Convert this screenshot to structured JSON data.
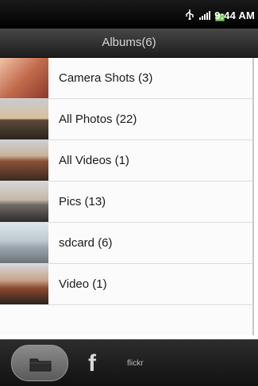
{
  "status_bar": {
    "time": "9:44 AM",
    "icons": [
      "usb-icon",
      "signal-icon",
      "battery-icon"
    ]
  },
  "title_bar": {
    "title": "Albums(6)"
  },
  "albums": [
    {
      "label": "Camera Shots (3)"
    },
    {
      "label": "All Photos (22)"
    },
    {
      "label": "All Videos (1)"
    },
    {
      "label": "Pics (13)"
    },
    {
      "label": "sdcard (6)"
    },
    {
      "label": "Video (1)"
    }
  ],
  "bottom_tabs": [
    {
      "label": "",
      "icon": "folder-icon"
    },
    {
      "label": "f",
      "icon": "facebook-icon"
    },
    {
      "label": "flickr",
      "icon": "flickr-icon"
    }
  ],
  "colors": {
    "battery": "#7ad15a"
  }
}
